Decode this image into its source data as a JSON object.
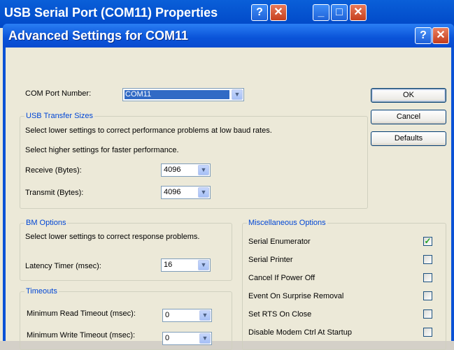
{
  "background_window": {
    "title": "USB Serial Port (COM11) Properties"
  },
  "dialog": {
    "title": "Advanced Settings for COM11",
    "help_glyph": "?",
    "close_glyph": "✕"
  },
  "com_port": {
    "label": "COM Port Number:",
    "value": "COM11"
  },
  "usb_transfer": {
    "title": "USB Transfer Sizes",
    "hint1": "Select lower settings to correct performance problems at low baud rates.",
    "hint2": "Select higher settings for faster performance.",
    "receive_label": "Receive (Bytes):",
    "receive_value": "4096",
    "transmit_label": "Transmit (Bytes):",
    "transmit_value": "4096"
  },
  "bm_options": {
    "title": "BM Options",
    "hint": "Select lower settings to correct response problems.",
    "latency_label": "Latency Timer (msec):",
    "latency_value": "16"
  },
  "timeouts": {
    "title": "Timeouts",
    "read_label": "Minimum Read Timeout (msec):",
    "read_value": "0",
    "write_label": "Minimum Write Timeout (msec):",
    "write_value": "0"
  },
  "misc": {
    "title": "Miscellaneous Options",
    "options": [
      {
        "label": "Serial Enumerator",
        "checked": true
      },
      {
        "label": "Serial Printer",
        "checked": false
      },
      {
        "label": "Cancel If Power Off",
        "checked": false
      },
      {
        "label": "Event On Surprise Removal",
        "checked": false
      },
      {
        "label": "Set RTS On Close",
        "checked": false
      },
      {
        "label": "Disable Modem Ctrl At Startup",
        "checked": false
      }
    ]
  },
  "buttons": {
    "ok": "OK",
    "cancel": "Cancel",
    "defaults": "Defaults"
  },
  "colors": {
    "titlebar": "#0a53d8",
    "group_title": "#0046d5",
    "dialog_bg": "#ece9d8",
    "check": "#21a121"
  }
}
